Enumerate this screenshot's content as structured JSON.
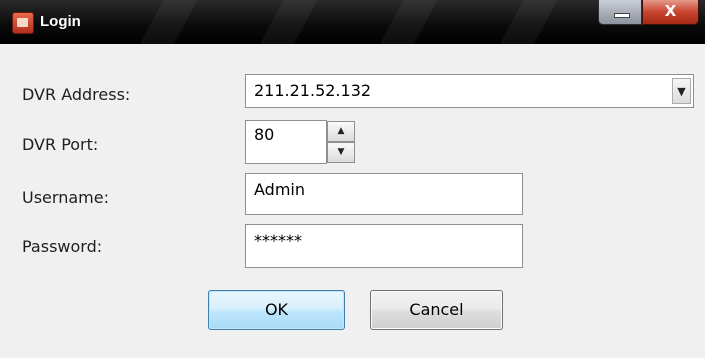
{
  "window": {
    "title": "Login",
    "close_glyph": "X"
  },
  "form": {
    "dvr_address": {
      "label": "DVR Address:",
      "value": "211.21.52.132"
    },
    "dvr_port": {
      "label": "DVR Port:",
      "value": "80"
    },
    "username": {
      "label": "Username:",
      "value": "Admin"
    },
    "password": {
      "label": "Password:",
      "value": "******"
    }
  },
  "buttons": {
    "ok_label": "OK",
    "cancel_label": "Cancel"
  },
  "icons": {
    "app": "login-app-icon",
    "minimize": "minimize-icon",
    "close": "close-icon",
    "dropdown": "chevron-down-icon",
    "spin_up": "spin-up-icon",
    "spin_down": "spin-down-icon"
  }
}
